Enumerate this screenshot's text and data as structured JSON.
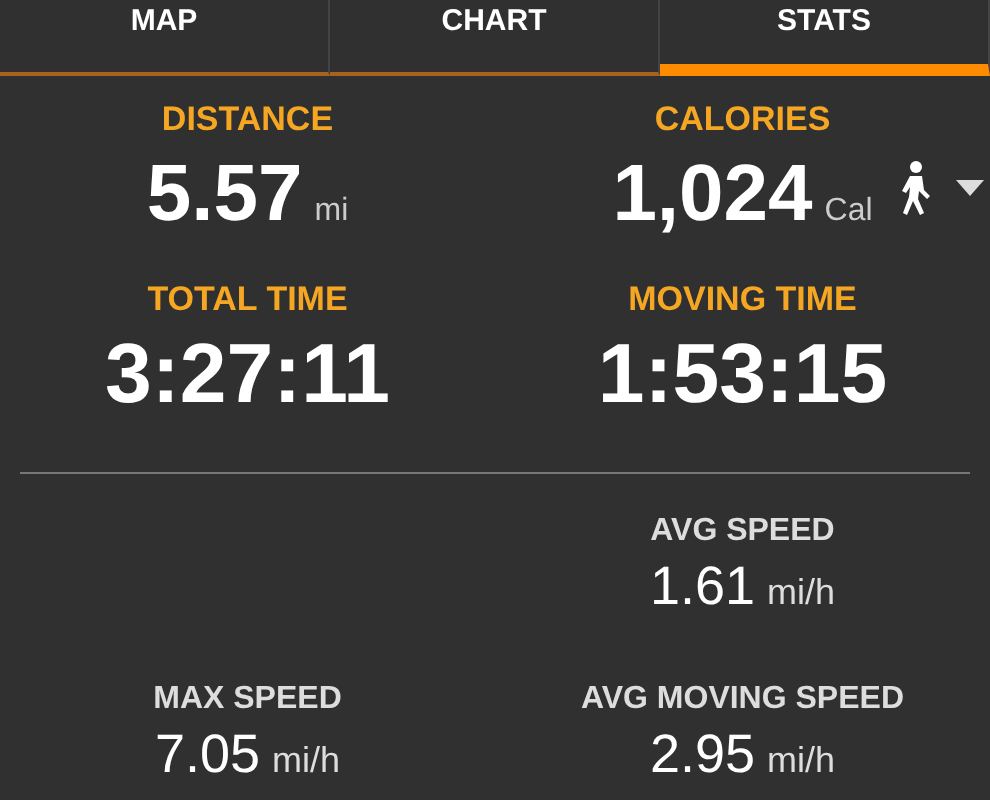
{
  "tabs": [
    {
      "label": "MAP",
      "selected": false
    },
    {
      "label": "CHART",
      "selected": false
    },
    {
      "label": "STATS",
      "selected": true
    }
  ],
  "primary_stats": [
    {
      "label": "DISTANCE",
      "value": "5.57",
      "unit": "mi"
    },
    {
      "label": "CALORIES",
      "value": "1,024",
      "unit": "Cal",
      "activity_selector": true
    },
    {
      "label": "TOTAL TIME",
      "value": "3:27:11"
    },
    {
      "label": "MOVING TIME",
      "value": "1:53:15"
    }
  ],
  "secondary_rows": [
    [
      {
        "kind": "empty"
      },
      {
        "kind": "stat",
        "label": "AVG SPEED",
        "value": "1.61",
        "unit": "mi/h"
      }
    ],
    [
      {
        "kind": "stat",
        "label": "MAX SPEED",
        "value": "7.05",
        "unit": "mi/h"
      },
      {
        "kind": "stat",
        "label": "AVG MOVING SPEED",
        "value": "2.95",
        "unit": "mi/h"
      }
    ]
  ]
}
